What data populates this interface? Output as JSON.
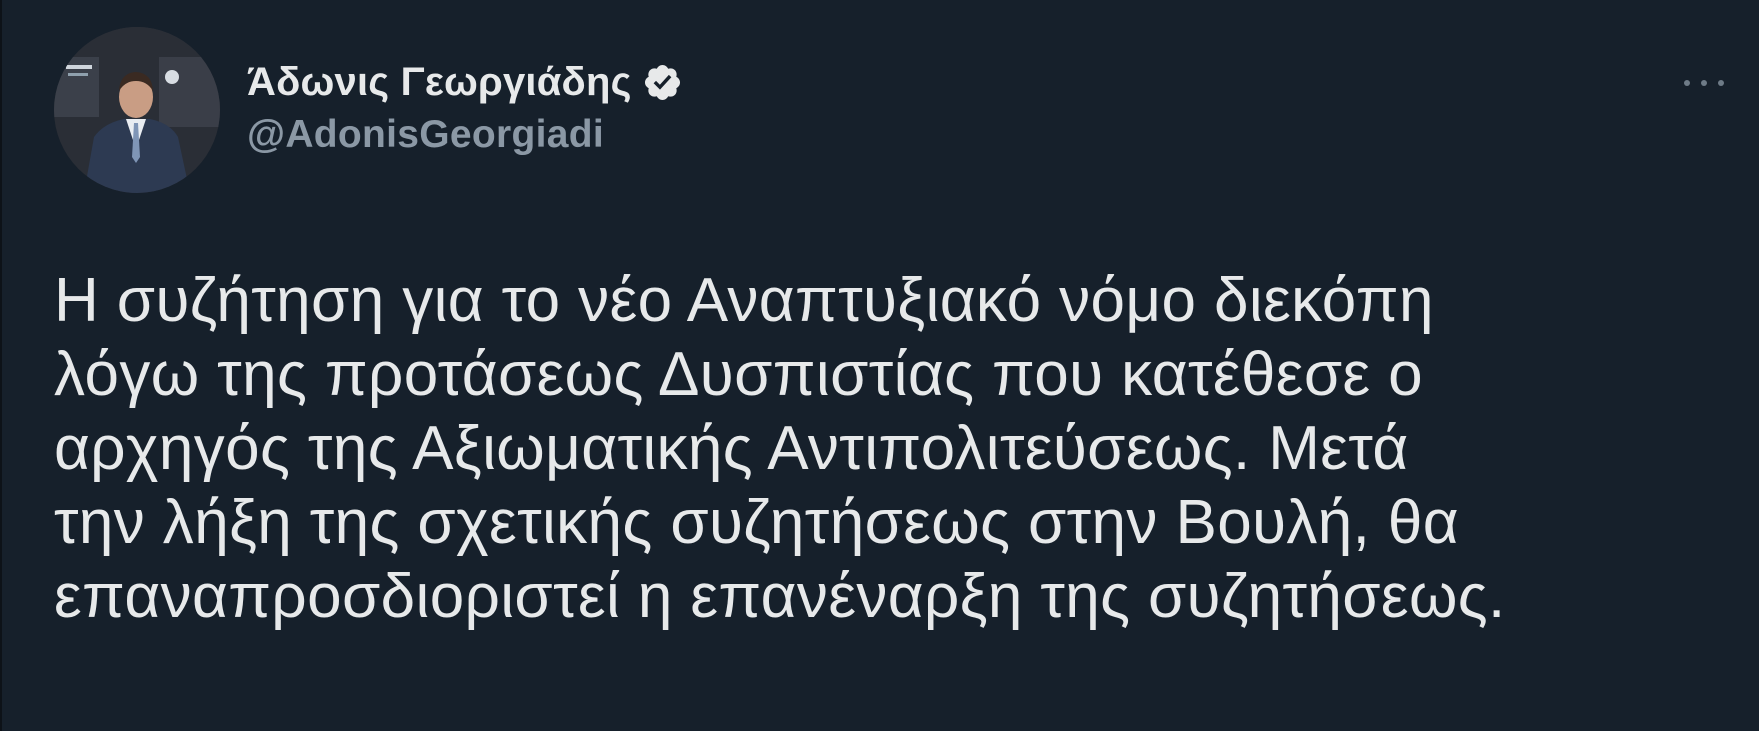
{
  "tweet": {
    "author": {
      "display_name": "Άδωνις Γεωργιάδης",
      "handle": "@AdonisGeorgiadi",
      "verified": true,
      "verified_icon": "verified-badge-icon",
      "avatar_icon": "profile-photo"
    },
    "more_icon": "more-options-icon",
    "text_lines": [
      "Η συζήτηση για το νέο Αναπτυξιακό νόμο διεκόπη",
      "λόγω της προτάσεως Δυσπιστίας που κατέθεσε ο",
      "αρχηγός της Αξιωματικής Αντιπολιτεύσεως. Μετά",
      "την λήξη της σχετικής συζητήσεως στην Βουλή, θα",
      "επαναπροσδιοριστεί η επανέναρξη της συζητήσεως."
    ]
  },
  "colors": {
    "background": "#16202b",
    "primary_text": "#e7e9ea",
    "secondary_text": "#8b98a5"
  }
}
